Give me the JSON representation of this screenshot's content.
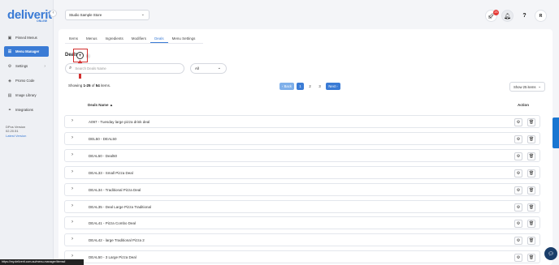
{
  "app": {
    "logo": "deliverit",
    "logo_sub": "ONLINE"
  },
  "sidebar": {
    "items": [
      {
        "label": "Pinned Menus",
        "icon": "pin-icon"
      },
      {
        "label": "Menu Manager",
        "icon": "menu-icon",
        "active": true
      },
      {
        "label": "Settings",
        "icon": "gear-icon"
      },
      {
        "label": "Promo Code",
        "icon": "tag-icon"
      },
      {
        "label": "Image Library",
        "icon": "image-icon"
      },
      {
        "label": "Integrations",
        "icon": "link-icon"
      }
    ],
    "version_label": "DPos Version",
    "version_number": "02.20.51",
    "latest_version_label": "Latest Version"
  },
  "topbar": {
    "store_name": "Studio Sample Store",
    "notification_count": "23"
  },
  "tabs": [
    {
      "label": "Items"
    },
    {
      "label": "Menus"
    },
    {
      "label": "Ingredients"
    },
    {
      "label": "Modifiers"
    },
    {
      "label": "Deals",
      "active": true
    },
    {
      "label": "Menu Settings"
    }
  ],
  "page": {
    "title": "Deals",
    "search_placeholder": "Search Deals Name",
    "filter_value": "All",
    "showing_prefix": "Showing ",
    "showing_range": "1-25",
    "showing_of": " of ",
    "showing_total": "54",
    "showing_suffix": " items.",
    "show_items_label": "Show 25 items"
  },
  "pagination": {
    "back": "‹ Back",
    "pages": [
      "1",
      "2",
      "3"
    ],
    "current": "1",
    "next": "Next ›"
  },
  "table": {
    "col_name": "Deals Name ▲",
    "col_action": "Action",
    "rows": [
      "A097 - Tuesday large pizza drink deal",
      "DEL50 - DEAL50",
      "DEAL50 - Deal50",
      "DEAL33 - Small Pizza Deal",
      "DEAL34 - Traditional Pizza Deal",
      "DEAL35 - Deal Large Pizza Traditional",
      "DEAL41 - Pizza Combo Deal",
      "DEAL42 - large Traditional Pizza 2",
      "DEAL50 - 3 Large Pizza Deal"
    ]
  },
  "statusbar": {
    "url": "https://my.deliverit.com.au/menu-manager/items#"
  },
  "colors": {
    "primary": "#3a7bd5",
    "highlight": "#d32f2f"
  }
}
